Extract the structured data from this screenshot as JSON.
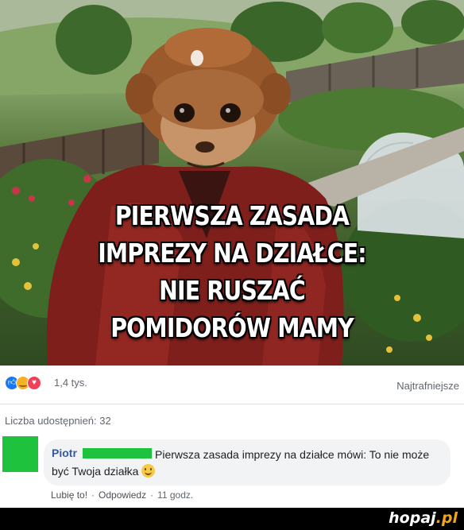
{
  "meme": {
    "caption": [
      "PIERWSZA ZASADA",
      "IMPREZY NA DZIAŁCE:",
      "NIE RUSZAĆ",
      "POMIDORÓW MAMY"
    ]
  },
  "reactions": {
    "icons": [
      "like-icon",
      "haha-icon",
      "love-icon"
    ],
    "count": "1,4 tys.",
    "sort": "Najtrafniejsze"
  },
  "shares": "Liczba udostępnień: 32",
  "comment": {
    "author": "Piotr",
    "text": "Pierwsza zasada imprezy na działce mówi: To nie może być Twoja działka",
    "emoji": "smile-emoji",
    "actions": {
      "like": "Lubię to!",
      "reply": "Odpowiedz",
      "time": "11 godz."
    }
  },
  "footer": {
    "logo_main": "hopaj",
    "logo_accent": ".pl"
  },
  "colors": {
    "link": "#385898",
    "meta_text": "#606770",
    "bubble": "#f2f3f5",
    "redaction_green": "#1ec23c",
    "logo_accent": "#f2a41b"
  }
}
